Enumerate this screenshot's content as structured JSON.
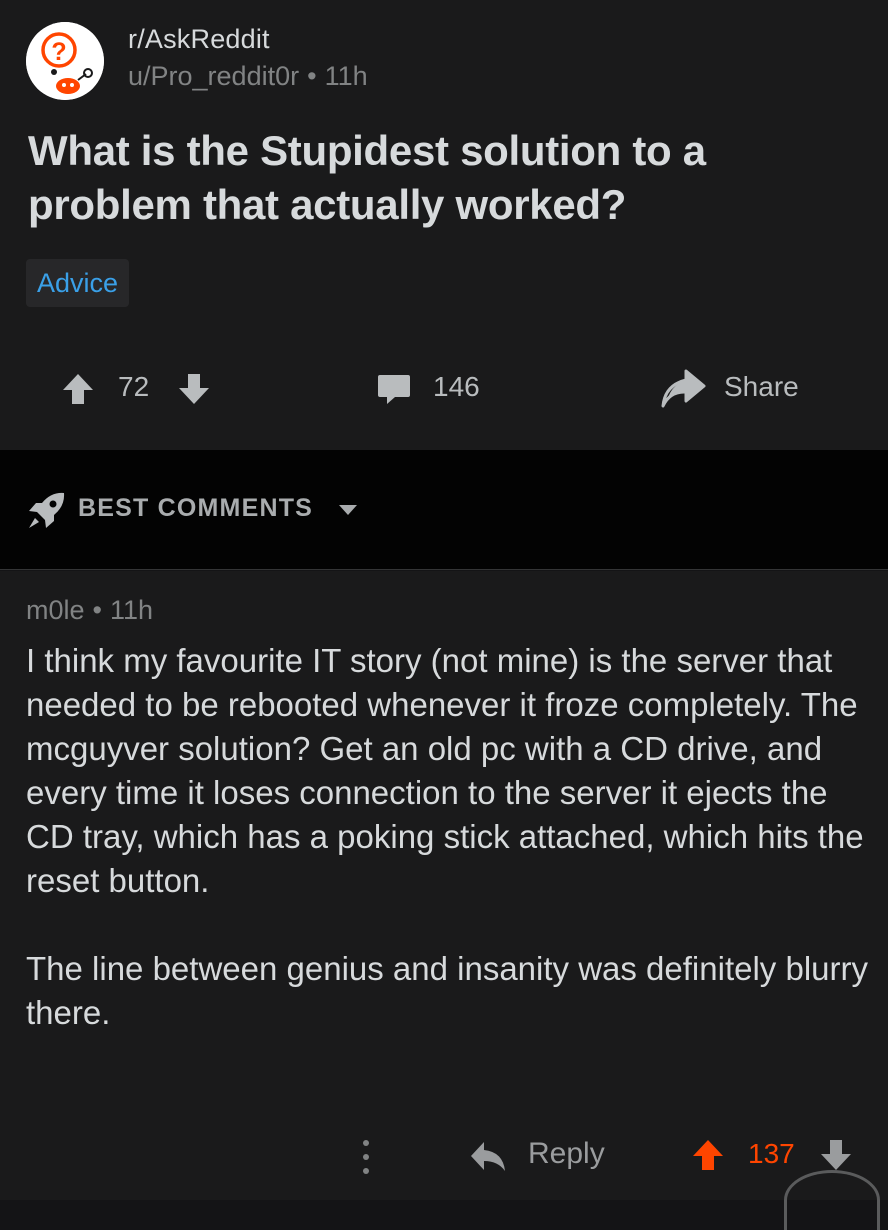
{
  "post": {
    "subreddit": "r/AskReddit",
    "author": "u/Pro_reddit0r",
    "separator": "•",
    "age": "11h",
    "title": "What is the Stupidest solution to a problem that actually worked?",
    "flair": "Advice",
    "score": "72",
    "comment_count": "146",
    "share_label": "Share"
  },
  "sort": {
    "label": "BEST COMMENTS",
    "icon": "rocket-icon"
  },
  "comment": {
    "author": "m0le",
    "separator": "•",
    "age": "11h",
    "paragraphs": [
      "I think my favourite IT story (not mine) is the server that needed to be rebooted whenever it froze completely. The mcguyver solution? Get an old pc with a CD drive, and every time it loses connection to the server it ejects the CD tray, which has a poking stick attached, which hits the reset button.",
      "The line between genius and insanity was definitely blurry there."
    ],
    "reply_label": "Reply",
    "score": "137"
  },
  "colors": {
    "background": "#1a1a1b",
    "sort_bar": "#030303",
    "text": "#d7dadc",
    "meta": "#818384",
    "flair_text": "#3aa0e8",
    "upvote_active": "#ff4500"
  }
}
